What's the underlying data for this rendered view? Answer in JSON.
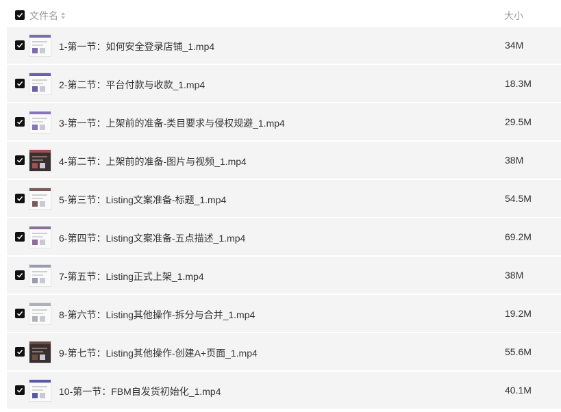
{
  "header": {
    "name_label": "文件名",
    "size_label": "大小"
  },
  "colors": {
    "row_bg": "#f4f4f4",
    "checkbox": "#111111",
    "header_text": "#999999"
  },
  "files": [
    {
      "name": "1-第一节：如何安全登录店铺_1.mp4",
      "size": "34M",
      "thumb": "light",
      "accent": "#7b6bb0"
    },
    {
      "name": "2-第二节：平台付款与收款_1.mp4",
      "size": "18.3M",
      "thumb": "light",
      "accent": "#6b5fa8"
    },
    {
      "name": "3-第一节：上架前的准备-类目要求与侵权规避_1.mp4",
      "size": "29.5M",
      "thumb": "light",
      "accent": "#8a74b8"
    },
    {
      "name": "4-第二节：上架前的准备-图片与视频_1.mp4",
      "size": "38M",
      "thumb": "dark",
      "accent": "#a05050"
    },
    {
      "name": "5-第三节：Listing文案准备-标题_1.mp4",
      "size": "54.5M",
      "thumb": "light",
      "accent": "#7a5a5a"
    },
    {
      "name": "6-第四节：Listing文案准备-五点描述_1.mp4",
      "size": "69.2M",
      "thumb": "light",
      "accent": "#8a6f9a"
    },
    {
      "name": "7-第五节：Listing正式上架_1.mp4",
      "size": "38M",
      "thumb": "light",
      "accent": "#9a9ab0"
    },
    {
      "name": "8-第六节：Listing其他操作-拆分与合并_1.mp4",
      "size": "19.2M",
      "thumb": "light",
      "accent": "#b0b0b8"
    },
    {
      "name": "9-第七节：Listing其他操作-创建A+页面_1.mp4",
      "size": "55.6M",
      "thumb": "dark",
      "accent": "#6a5040"
    },
    {
      "name": "10-第一节：FBM自发货初始化_1.mp4",
      "size": "40.1M",
      "thumb": "light",
      "accent": "#5a5aa0"
    }
  ]
}
